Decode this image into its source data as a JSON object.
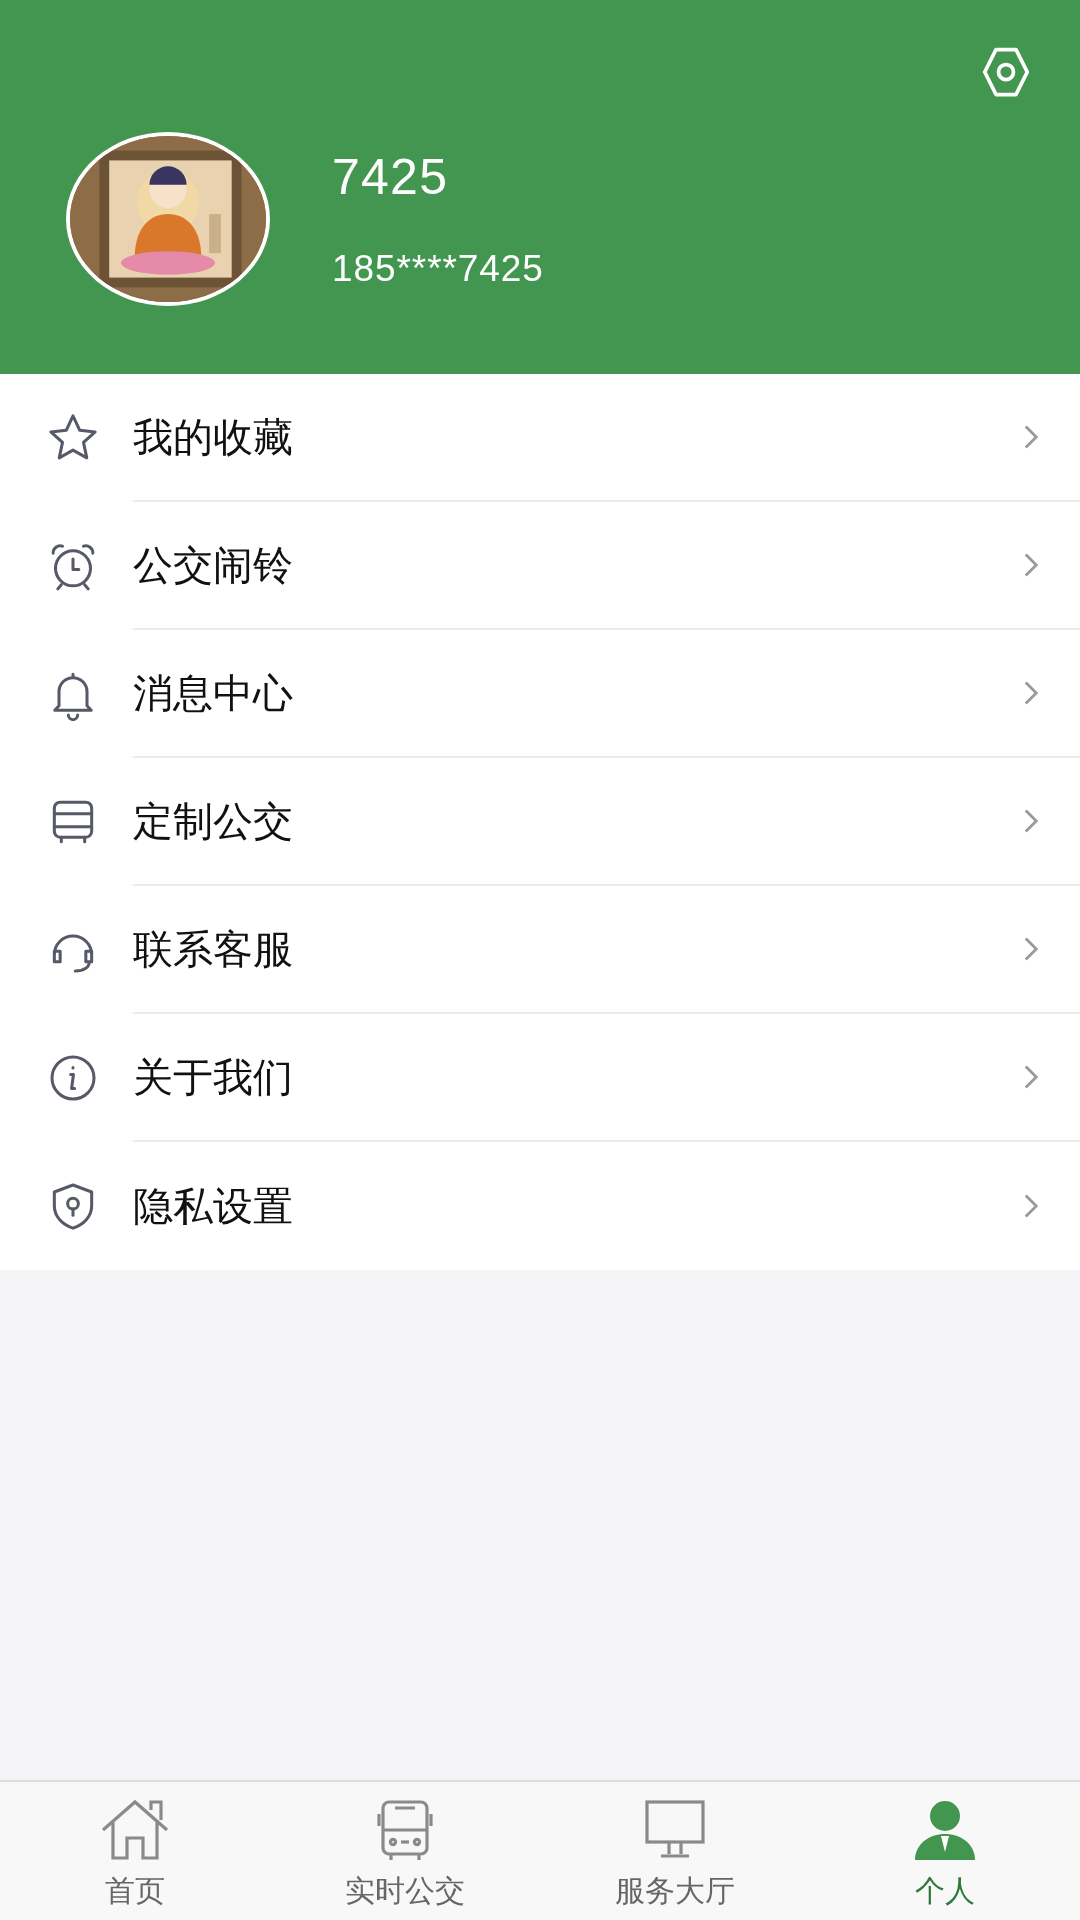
{
  "profile": {
    "name": "7425",
    "phone": "185****7425"
  },
  "menu": [
    {
      "label": "我的收藏"
    },
    {
      "label": "公交闹铃"
    },
    {
      "label": "消息中心"
    },
    {
      "label": "定制公交"
    },
    {
      "label": "联系客服"
    },
    {
      "label": "关于我们"
    },
    {
      "label": "隐私设置"
    }
  ],
  "tab_bar": [
    {
      "label": "首页",
      "selected": false
    },
    {
      "label": "实时公交",
      "selected": false
    },
    {
      "label": "服务大厅",
      "selected": false
    },
    {
      "label": "个人",
      "selected": true
    }
  ]
}
